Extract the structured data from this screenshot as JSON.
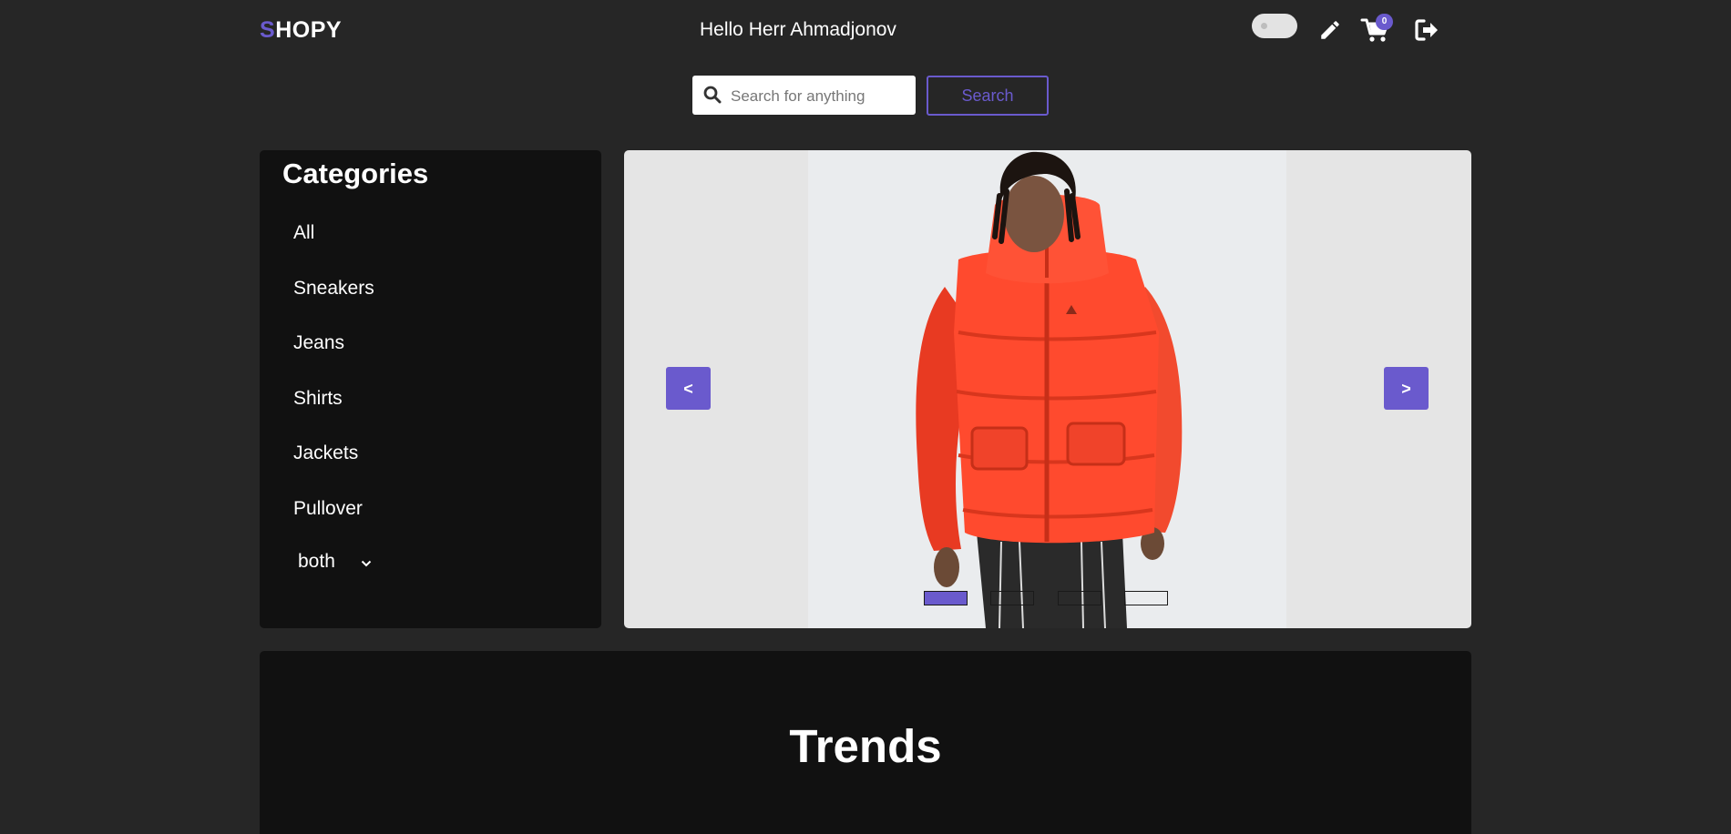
{
  "header": {
    "logo_first_letter": "S",
    "logo_rest": "HOPY",
    "greeting": "Hello Herr Ahmadjonov",
    "cart_count": "0",
    "icons": [
      "theme-toggle",
      "pencil-icon",
      "cart-icon",
      "logout-icon"
    ]
  },
  "search": {
    "placeholder": "Search for anything",
    "value": "",
    "button_label": "Search"
  },
  "categories": {
    "title": "Categories",
    "items": [
      {
        "label": "All"
      },
      {
        "label": "Sneakers"
      },
      {
        "label": "Jeans"
      },
      {
        "label": "Shirts"
      },
      {
        "label": "Jackets"
      },
      {
        "label": "Pullover"
      }
    ],
    "filter_selected": "both"
  },
  "carousel": {
    "prev_label": "<",
    "next_label": ">",
    "slide_count": 4,
    "active_slide": 1,
    "image": "man-in-red-puffer-jacket"
  },
  "trends": {
    "title": "Trends"
  },
  "colors": {
    "accent": "#6a5acd",
    "background": "#262626",
    "panel": "#111111",
    "jacket": "#ff4a2e"
  }
}
